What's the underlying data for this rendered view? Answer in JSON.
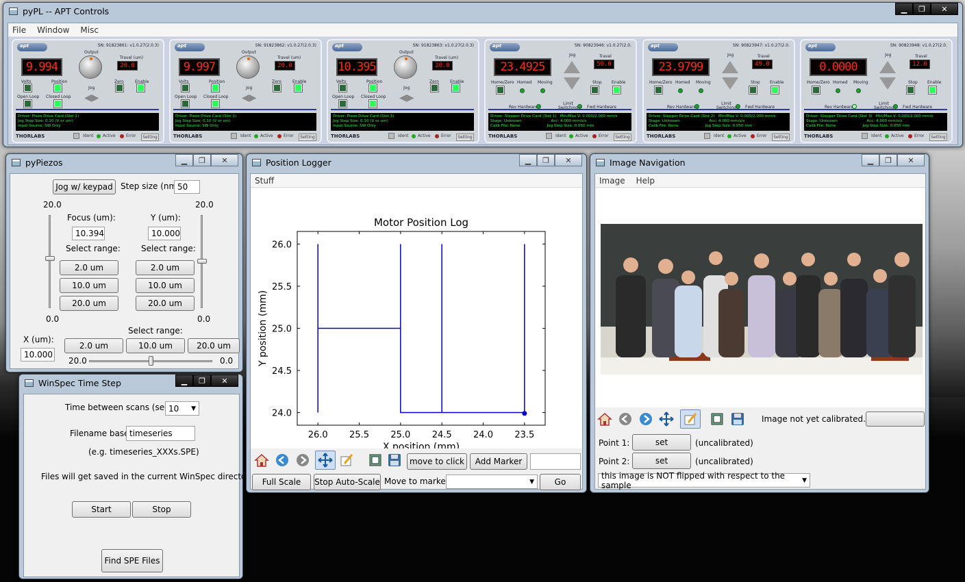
{
  "apt_window": {
    "title": "pyPL -- APT Controls",
    "menu": [
      "File",
      "Window",
      "Misc"
    ],
    "panels": [
      {
        "sn": "SN: 91823861: v1.0.27(2.0.3)",
        "type": "piezo",
        "display": "9.994",
        "travel": "20.0",
        "info": "Driver: Piezo Drive Card (Slot 1)\nJog Step Size: 0.10 (V or um)\nInput Source: SW Only"
      },
      {
        "sn": "SN: 91823862: v1.0.27(2.0.3)",
        "type": "piezo",
        "display": "9.997",
        "travel": "20.0",
        "info": "Driver: Piezo Drive Card (Slot 2)\nJog Step Size: 0.10 (V or um)\nInput Source: SW Only"
      },
      {
        "sn": "SN: 91823863: v1.0.27(2.0.3)",
        "type": "piezo",
        "display": "10.395",
        "travel": "20.0",
        "info": "Driver: Piezo Drive Card (Slot 3)\nJog Step Size: 0.10 (V or um)\nInput Source: SW Only"
      },
      {
        "sn": "SN: 90823946: v1.0.27(2.0.",
        "type": "stepper",
        "display": "23.4925",
        "travel": "50.0",
        "info": "Driver: Stepper Drive Card (Slot 1)   Min/Max V: 0.000/2.000 mm/s\nStage: Unknown                        Acc: 4.000 mm/s/s\nCalib File: None                      Jog Step Size: 0.050 mm"
      },
      {
        "sn": "SN: 90823947: v1.0.27(2.0.",
        "type": "stepper",
        "display": "23.9799",
        "travel": "49.0",
        "info": "Driver: Stepper Drive Card (Slot 2)   Min/Max V: 0.000/2.000 mm/s\nStage: Unknown                        Acc: 4.000 mm/s/s\nCalib File: None                      Jog Step Size: 0.050 mm"
      },
      {
        "sn": "SN: 90823948: v1.0.27(2.0.",
        "type": "stepper",
        "display": "0.0000",
        "travel": "12.0",
        "info": "Driver: Stepper Drive Card (Slot 3)   Min/Max V: 0.000/2.000 mm/s\nStage: Unknown                        Acc: 4.000 mm/s/s\nCalib File: None                      Jog Step Size: 0.050 mm"
      }
    ],
    "piezo_labels": {
      "output": "Output",
      "travel": "Travel (um)",
      "volts": "Volts",
      "position": "Position",
      "jog": "Jog",
      "zero": "Zero",
      "enable": "Enable",
      "open_loop": "Open Loop",
      "closed_loop": "Closed Loop"
    },
    "stepper_labels": {
      "jog": "Jog",
      "travel": "Travel",
      "home_zero": "Home/Zero",
      "homed": "Homed",
      "moving": "Moving",
      "stop": "Stop",
      "enable": "Enable",
      "rev_hw": "Rev Hardware",
      "limit": "Limit\nSwitching",
      "fwd_hw": "Fwd Hardware"
    },
    "footer": {
      "brand": "THORLABS",
      "ident": "Ident",
      "active": "Active",
      "error": "Error",
      "setting": "Setting"
    }
  },
  "pypiezos": {
    "title": "pyPiezos",
    "jog_button": "Jog w/ keypad",
    "step_label": "Step size (nm):",
    "step_value": "50",
    "focus_label": "Focus (um):",
    "focus_value": "10.394",
    "y_label": "Y (um):",
    "y_value": "10.000",
    "select_range": "Select range:",
    "ranges": [
      "2.0 um",
      "10.0 um",
      "20.0 um"
    ],
    "max": "20.0",
    "min": "0.0",
    "x_label": "X (um):",
    "x_value": "10.000",
    "x_min_label": "20.0",
    "x_max_label": "0.0"
  },
  "winspec": {
    "title": "WinSpec Time Step",
    "time_label": "Time between scans (sec.):",
    "time_value": "10",
    "filename_label": "Filename base:",
    "filename_value": "timeseries",
    "example": "(e.g. timeseries_XXXs.SPE)",
    "note": "Files will get saved in the current WinSpec directory.",
    "start": "Start",
    "stop": "Stop",
    "find": "Find SPE Files"
  },
  "logger": {
    "title": "Position Logger",
    "menu": "Stuff",
    "move_to_click": "move to click",
    "add_marker": "Add Marker",
    "full_scale": "Full Scale",
    "stop_autoscale": "Stop Auto-Scale",
    "move_to_marker": "Move to marker:",
    "go": "Go"
  },
  "chart_data": {
    "type": "line",
    "title": "Motor Position Log",
    "xlabel": "X position (mm)",
    "ylabel": "Y position (mm)",
    "xlim": [
      26.25,
      23.25
    ],
    "ylim": [
      23.85,
      26.15
    ],
    "xticks": [
      "26.0",
      "25.5",
      "25.0",
      "24.5",
      "24.0",
      "23.5"
    ],
    "yticks": [
      "24.0",
      "24.5",
      "25.0",
      "25.5",
      "26.0"
    ],
    "series": [
      {
        "x": [
          26.0,
          26.0,
          26.0,
          25.0,
          25.0,
          25.0,
          25.0,
          24.5,
          24.5,
          24.5,
          23.5,
          23.5,
          23.5
        ],
        "y": [
          24.0,
          26.0,
          25.0,
          25.0,
          26.0,
          24.0,
          24.0,
          24.0,
          26.0,
          24.0,
          24.0,
          26.0,
          24.0
        ]
      }
    ],
    "current_point": {
      "x": 23.5,
      "y": 23.99
    },
    "color": "#0000cc"
  },
  "imagenav": {
    "title": "Image Navigation",
    "menu": [
      "Image",
      "Help"
    ],
    "status": "Image not yet calibrated.",
    "point1": "Point 1:",
    "point2": "Point 2:",
    "set": "set",
    "uncal": "(uncalibrated)",
    "flip": "this image is NOT flipped with respect to the sample"
  }
}
